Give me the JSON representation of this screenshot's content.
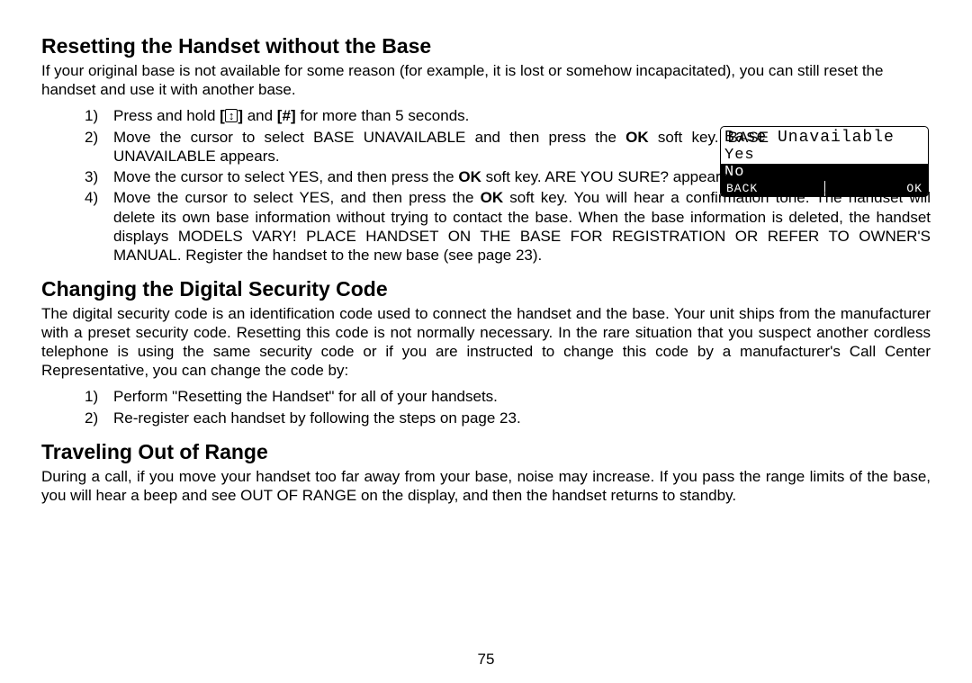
{
  "section1": {
    "heading": "Resetting the Handset without the Base",
    "intro": "If your original base is not available for some reason (for example, it is lost or somehow incapacitated), you can still reset the handset and use it with another base.",
    "steps": [
      {
        "num": "1)",
        "pre": "Press and hold ",
        "icon1": "↕",
        "mid": " and ",
        "icon2": "#",
        "post": " for more than 5 seconds."
      },
      {
        "num": "2)",
        "pre": "Move the cursor to select BASE UNAVAILABLE and then press the ",
        "bold": "OK",
        "post": " soft key. BASE UNAVAILABLE appears."
      },
      {
        "num": "3)",
        "pre": "Move the cursor to select YES, and then press the ",
        "bold": "OK",
        "post": " soft key. ARE YOU SURE? appears."
      },
      {
        "num": "4)",
        "pre": "Move the cursor to select YES, and then press the ",
        "bold": "OK",
        "post": " soft key. You will hear a confirmation tone. The handset will delete its own base information without trying to contact the base. When the base information is deleted, the handset displays MODELS VARY! PLACE HANDSET ON THE BASE FOR REGISTRATION OR REFER TO OWNER'S MANUAL. Register the handset to the new base (see page 23)."
      }
    ]
  },
  "section2": {
    "heading": "Changing the Digital Security Code",
    "intro": "The digital security code is an identification code used to connect the handset and the base. Your unit ships from the manufacturer with a preset security code. Resetting this code is not normally necessary. In the rare situation that you suspect another cordless telephone is using the same security code or if you are instructed to change this code by a manufacturer's Call Center Representative, you can change the code by:",
    "steps": [
      {
        "num": "1)",
        "text": "Perform \"Resetting the Handset\" for all of your handsets."
      },
      {
        "num": "2)",
        "text": "Re-register each handset by following the steps on page 23."
      }
    ]
  },
  "section3": {
    "heading": "Traveling Out of Range",
    "intro": "During a call, if you move your handset too far away from your base, noise may increase. If you pass the range limits of the base, you will hear a beep and see OUT OF RANGE on the display, and then the handset returns to standby."
  },
  "lcd": {
    "title": "Base Unavailable",
    "opt1": "Yes",
    "opt2": "No",
    "back": "BACK",
    "ok": "OK"
  },
  "pageNumber": "75"
}
